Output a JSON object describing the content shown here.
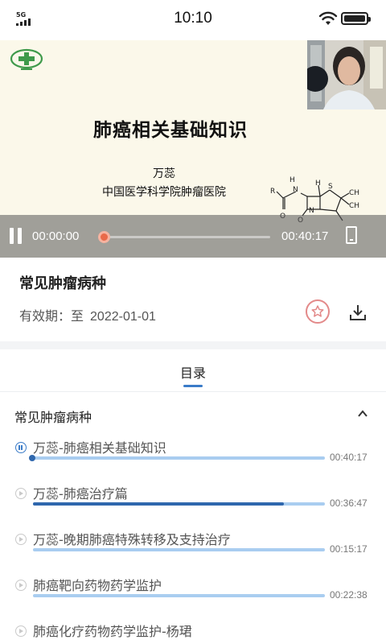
{
  "status_bar": {
    "network": "5G",
    "time": "10:10",
    "wifi_icon": "wifi-icon",
    "battery_icon": "battery-icon"
  },
  "video": {
    "slide": {
      "title": "肺癌相关基础知识",
      "author": "万蕊",
      "organization": "中国医学科学院肿瘤医院"
    },
    "player": {
      "current_time": "00:00:00",
      "total_time": "00:40:17",
      "progress": 0,
      "pause_icon": "pause-icon",
      "rotate_icon": "rotate-screen-icon"
    }
  },
  "course": {
    "title": "常见肿瘤病种",
    "validity_label": "有效期：至",
    "validity_date": "2022-01-01",
    "favorite_icon": "star-icon",
    "download_icon": "download-icon"
  },
  "tabs": [
    {
      "label": "目录",
      "active": true
    }
  ],
  "catalog": {
    "chapter_title": "常见肿瘤病种",
    "collapse_icon": "chevron-up-icon",
    "lessons": [
      {
        "name": "万蕊-肺癌相关基础知识",
        "duration": "00:40:17",
        "progress": 0.0,
        "playing": true
      },
      {
        "name": "万蕊-肺癌治疗篇",
        "duration": "00:36:47",
        "progress": 0.86,
        "playing": false
      },
      {
        "name": "万蕊-晚期肺癌特殊转移及支持治疗",
        "duration": "00:15:17",
        "progress": 0.0,
        "playing": false
      },
      {
        "name": "肺癌靶向药物药学监护",
        "duration": "00:22:38",
        "progress": 0.0,
        "playing": false
      },
      {
        "name": "肺癌化疗药物药学监护-杨珺",
        "duration": "",
        "progress": 0.0,
        "playing": false
      }
    ]
  },
  "colors": {
    "accent": "#3a7bc8",
    "progress_fill": "#2f67ad",
    "progress_track": "#a9cdf0",
    "scrub_knob": "#e96a4a",
    "favorite": "#e38a8a"
  }
}
